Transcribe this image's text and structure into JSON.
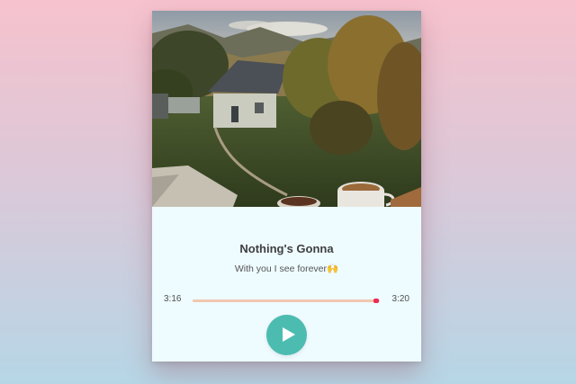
{
  "player": {
    "track_title": "Nothing's Gonna",
    "track_subtitle": "With you I see forever🙌",
    "current_time": "3:16",
    "total_time": "3:20",
    "progress_fraction": 0.98,
    "play_icon": "play-icon"
  },
  "colors": {
    "background_top": "#f6c2cd",
    "background_bottom": "#b6d6e6",
    "card_background": "#eefbff",
    "play_button": "#4dbcb0",
    "progress_knob": "#ee2a55",
    "progress_track": "#f7d0c9"
  }
}
